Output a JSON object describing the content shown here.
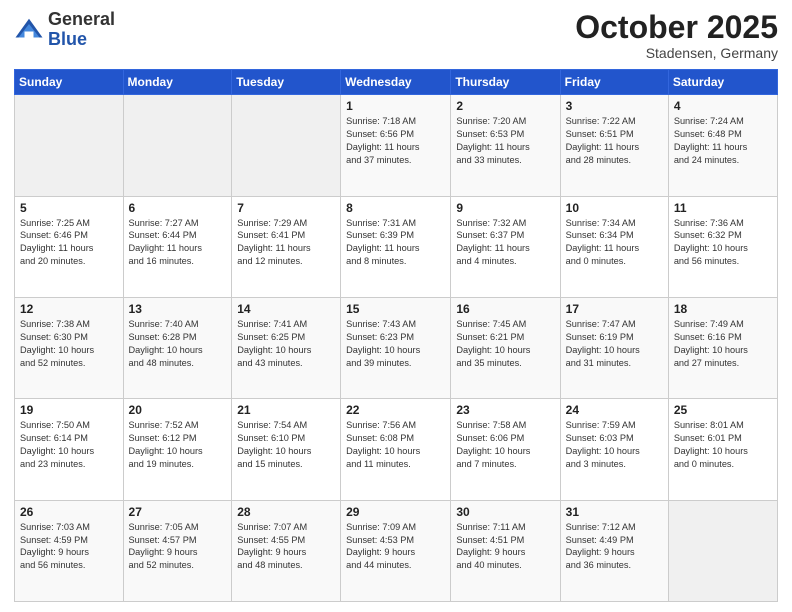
{
  "logo": {
    "general": "General",
    "blue": "Blue"
  },
  "title": "October 2025",
  "subtitle": "Stadensen, Germany",
  "days_header": [
    "Sunday",
    "Monday",
    "Tuesday",
    "Wednesday",
    "Thursday",
    "Friday",
    "Saturday"
  ],
  "weeks": [
    [
      {
        "day": "",
        "info": ""
      },
      {
        "day": "",
        "info": ""
      },
      {
        "day": "",
        "info": ""
      },
      {
        "day": "1",
        "info": "Sunrise: 7:18 AM\nSunset: 6:56 PM\nDaylight: 11 hours\nand 37 minutes."
      },
      {
        "day": "2",
        "info": "Sunrise: 7:20 AM\nSunset: 6:53 PM\nDaylight: 11 hours\nand 33 minutes."
      },
      {
        "day": "3",
        "info": "Sunrise: 7:22 AM\nSunset: 6:51 PM\nDaylight: 11 hours\nand 28 minutes."
      },
      {
        "day": "4",
        "info": "Sunrise: 7:24 AM\nSunset: 6:48 PM\nDaylight: 11 hours\nand 24 minutes."
      }
    ],
    [
      {
        "day": "5",
        "info": "Sunrise: 7:25 AM\nSunset: 6:46 PM\nDaylight: 11 hours\nand 20 minutes."
      },
      {
        "day": "6",
        "info": "Sunrise: 7:27 AM\nSunset: 6:44 PM\nDaylight: 11 hours\nand 16 minutes."
      },
      {
        "day": "7",
        "info": "Sunrise: 7:29 AM\nSunset: 6:41 PM\nDaylight: 11 hours\nand 12 minutes."
      },
      {
        "day": "8",
        "info": "Sunrise: 7:31 AM\nSunset: 6:39 PM\nDaylight: 11 hours\nand 8 minutes."
      },
      {
        "day": "9",
        "info": "Sunrise: 7:32 AM\nSunset: 6:37 PM\nDaylight: 11 hours\nand 4 minutes."
      },
      {
        "day": "10",
        "info": "Sunrise: 7:34 AM\nSunset: 6:34 PM\nDaylight: 11 hours\nand 0 minutes."
      },
      {
        "day": "11",
        "info": "Sunrise: 7:36 AM\nSunset: 6:32 PM\nDaylight: 10 hours\nand 56 minutes."
      }
    ],
    [
      {
        "day": "12",
        "info": "Sunrise: 7:38 AM\nSunset: 6:30 PM\nDaylight: 10 hours\nand 52 minutes."
      },
      {
        "day": "13",
        "info": "Sunrise: 7:40 AM\nSunset: 6:28 PM\nDaylight: 10 hours\nand 48 minutes."
      },
      {
        "day": "14",
        "info": "Sunrise: 7:41 AM\nSunset: 6:25 PM\nDaylight: 10 hours\nand 43 minutes."
      },
      {
        "day": "15",
        "info": "Sunrise: 7:43 AM\nSunset: 6:23 PM\nDaylight: 10 hours\nand 39 minutes."
      },
      {
        "day": "16",
        "info": "Sunrise: 7:45 AM\nSunset: 6:21 PM\nDaylight: 10 hours\nand 35 minutes."
      },
      {
        "day": "17",
        "info": "Sunrise: 7:47 AM\nSunset: 6:19 PM\nDaylight: 10 hours\nand 31 minutes."
      },
      {
        "day": "18",
        "info": "Sunrise: 7:49 AM\nSunset: 6:16 PM\nDaylight: 10 hours\nand 27 minutes."
      }
    ],
    [
      {
        "day": "19",
        "info": "Sunrise: 7:50 AM\nSunset: 6:14 PM\nDaylight: 10 hours\nand 23 minutes."
      },
      {
        "day": "20",
        "info": "Sunrise: 7:52 AM\nSunset: 6:12 PM\nDaylight: 10 hours\nand 19 minutes."
      },
      {
        "day": "21",
        "info": "Sunrise: 7:54 AM\nSunset: 6:10 PM\nDaylight: 10 hours\nand 15 minutes."
      },
      {
        "day": "22",
        "info": "Sunrise: 7:56 AM\nSunset: 6:08 PM\nDaylight: 10 hours\nand 11 minutes."
      },
      {
        "day": "23",
        "info": "Sunrise: 7:58 AM\nSunset: 6:06 PM\nDaylight: 10 hours\nand 7 minutes."
      },
      {
        "day": "24",
        "info": "Sunrise: 7:59 AM\nSunset: 6:03 PM\nDaylight: 10 hours\nand 3 minutes."
      },
      {
        "day": "25",
        "info": "Sunrise: 8:01 AM\nSunset: 6:01 PM\nDaylight: 10 hours\nand 0 minutes."
      }
    ],
    [
      {
        "day": "26",
        "info": "Sunrise: 7:03 AM\nSunset: 4:59 PM\nDaylight: 9 hours\nand 56 minutes."
      },
      {
        "day": "27",
        "info": "Sunrise: 7:05 AM\nSunset: 4:57 PM\nDaylight: 9 hours\nand 52 minutes."
      },
      {
        "day": "28",
        "info": "Sunrise: 7:07 AM\nSunset: 4:55 PM\nDaylight: 9 hours\nand 48 minutes."
      },
      {
        "day": "29",
        "info": "Sunrise: 7:09 AM\nSunset: 4:53 PM\nDaylight: 9 hours\nand 44 minutes."
      },
      {
        "day": "30",
        "info": "Sunrise: 7:11 AM\nSunset: 4:51 PM\nDaylight: 9 hours\nand 40 minutes."
      },
      {
        "day": "31",
        "info": "Sunrise: 7:12 AM\nSunset: 4:49 PM\nDaylight: 9 hours\nand 36 minutes."
      },
      {
        "day": "",
        "info": ""
      }
    ]
  ]
}
